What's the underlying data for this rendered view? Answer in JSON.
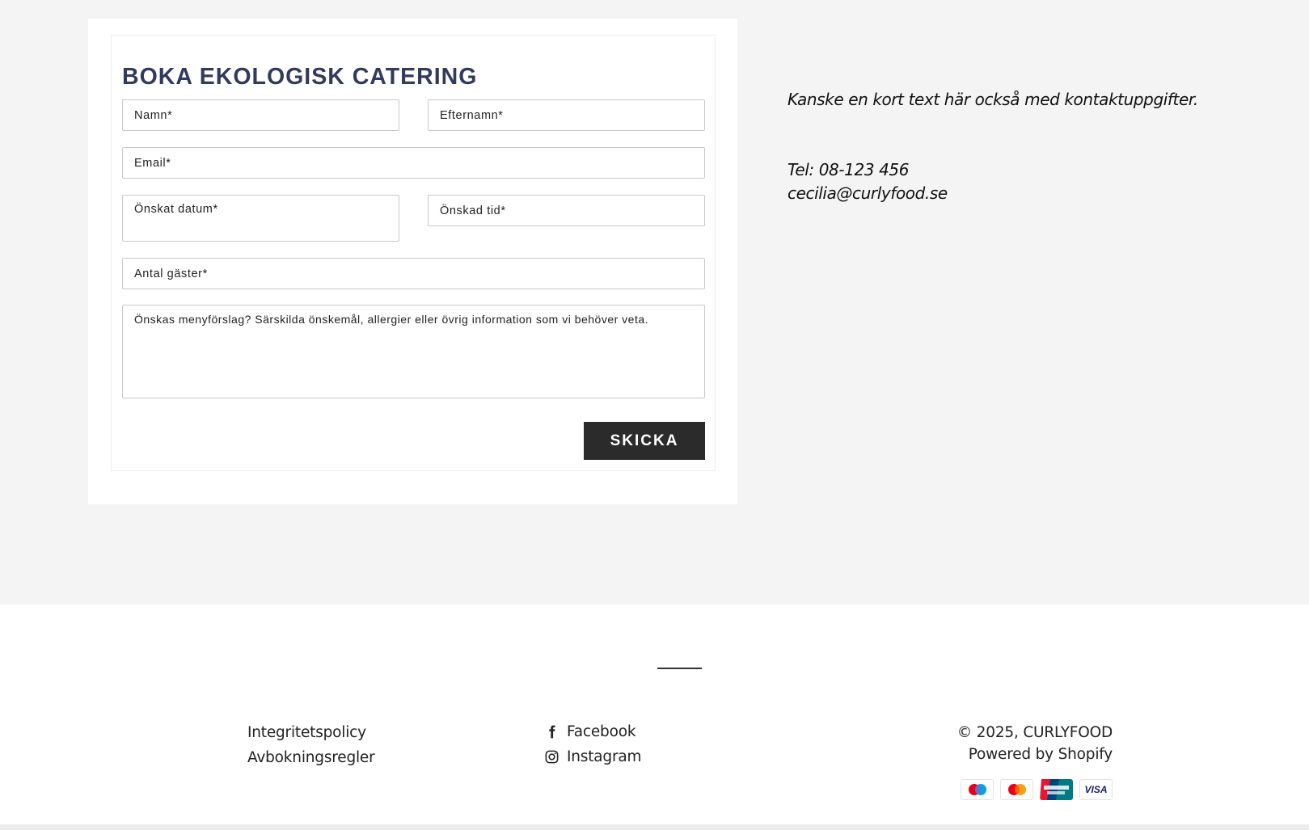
{
  "form": {
    "title": "BOKA EKOLOGISK CATERING",
    "fields": {
      "first_name": "Namn*",
      "last_name": "Efternamn*",
      "email": "Email*",
      "date": "Önskat datum*",
      "time": "Önskad tid*",
      "guests": "Antal gäster*",
      "message": "Önskas menyförslag? Särskilda önskemål, allergier eller övrig information som vi behöver veta."
    },
    "submit_label": "SKICKA"
  },
  "contact": {
    "intro": "Kanske en kort text här också med kontaktuppgifter.",
    "phone": "Tel: 08-123 456",
    "email": "cecilia@curlyfood.se"
  },
  "footer": {
    "links": [
      "Integritetspolicy",
      "Avbokningsregler"
    ],
    "social": [
      {
        "label": "Facebook",
        "icon": "facebook-icon"
      },
      {
        "label": "Instagram",
        "icon": "instagram-icon"
      }
    ],
    "copyright": "© 2025, CURLYFOOD",
    "powered": "Powered by Shopify",
    "payment_methods": [
      "Maestro",
      "Mastercard",
      "UnionPay",
      "Visa"
    ],
    "visa_text": "VISA"
  },
  "colors": {
    "title": "#323a5e",
    "button": "#2b2b2b",
    "page_bg": "#f4f4f4"
  }
}
